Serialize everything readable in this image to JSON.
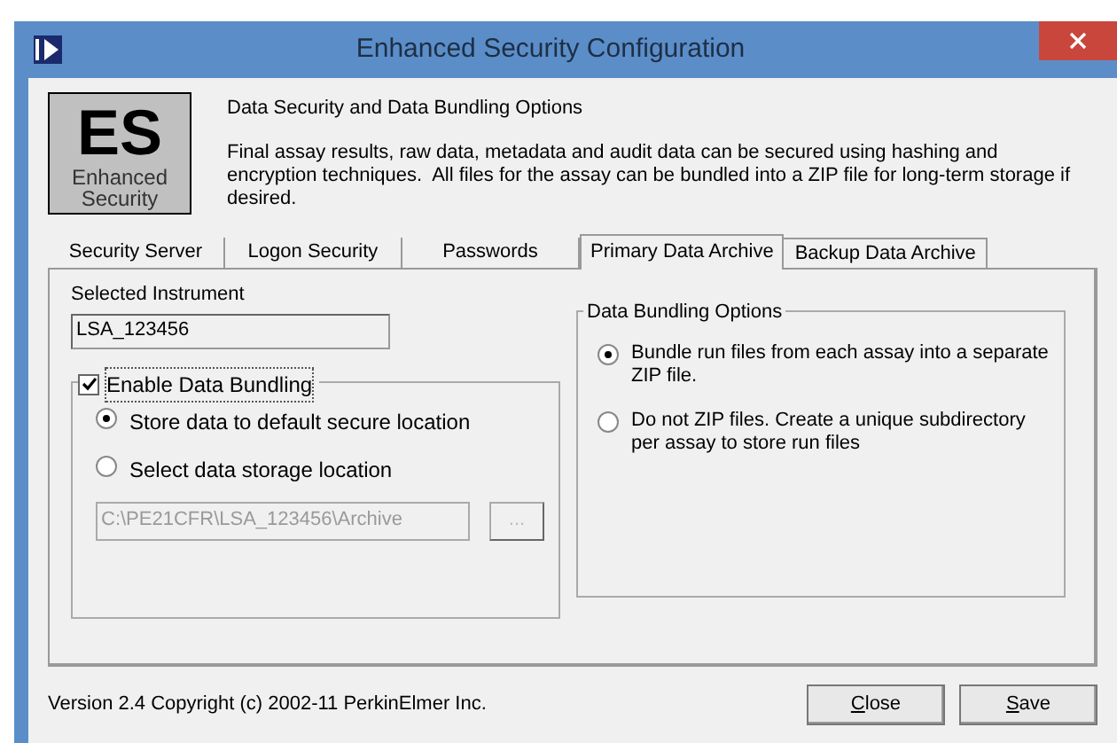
{
  "window": {
    "title": "Enhanced Security Configuration"
  },
  "logo": {
    "mark": "ES",
    "caption_line_1": "Enhanced",
    "caption_line_2": "Security"
  },
  "header": {
    "heading": "Data Security and Data Bundling Options",
    "description": "Final assay results, raw data, metadata and audit data can be secured using hashing and encryption techniques.  All files for the assay can be bundled into a ZIP file for long-term storage if desired."
  },
  "tabs": [
    {
      "label": "Security Server",
      "selected": false
    },
    {
      "label": "Logon Security",
      "selected": false
    },
    {
      "label": "Passwords",
      "selected": false
    },
    {
      "label": "Primary Data Archive",
      "selected": true
    },
    {
      "label": "Backup Data Archive",
      "selected": false
    }
  ],
  "selected_instrument": {
    "label": "Selected Instrument",
    "value": "LSA_123456"
  },
  "bundling": {
    "label": "Enable Data Bundling",
    "checked": true,
    "options": [
      {
        "label": "Store data to default secure location",
        "selected": true
      },
      {
        "label": "Select data storage location",
        "selected": false
      }
    ],
    "path": {
      "value": "C:\\PE21CFR\\LSA_123456\\Archive",
      "disabled": true
    },
    "browse_button": {
      "label": "...",
      "disabled": true
    }
  },
  "bundling_options": {
    "title": "Data Bundling Options",
    "options": [
      {
        "label": "Bundle run files from each assay into a separate ZIP file.",
        "selected": true
      },
      {
        "label": "Do not ZIP files.  Create a unique subdirectory per assay to store run files",
        "selected": false
      }
    ]
  },
  "status": "Version 2.4 Copyright (c) 2002-11 PerkinElmer Inc.",
  "buttons": [
    "Close",
    "Save"
  ]
}
